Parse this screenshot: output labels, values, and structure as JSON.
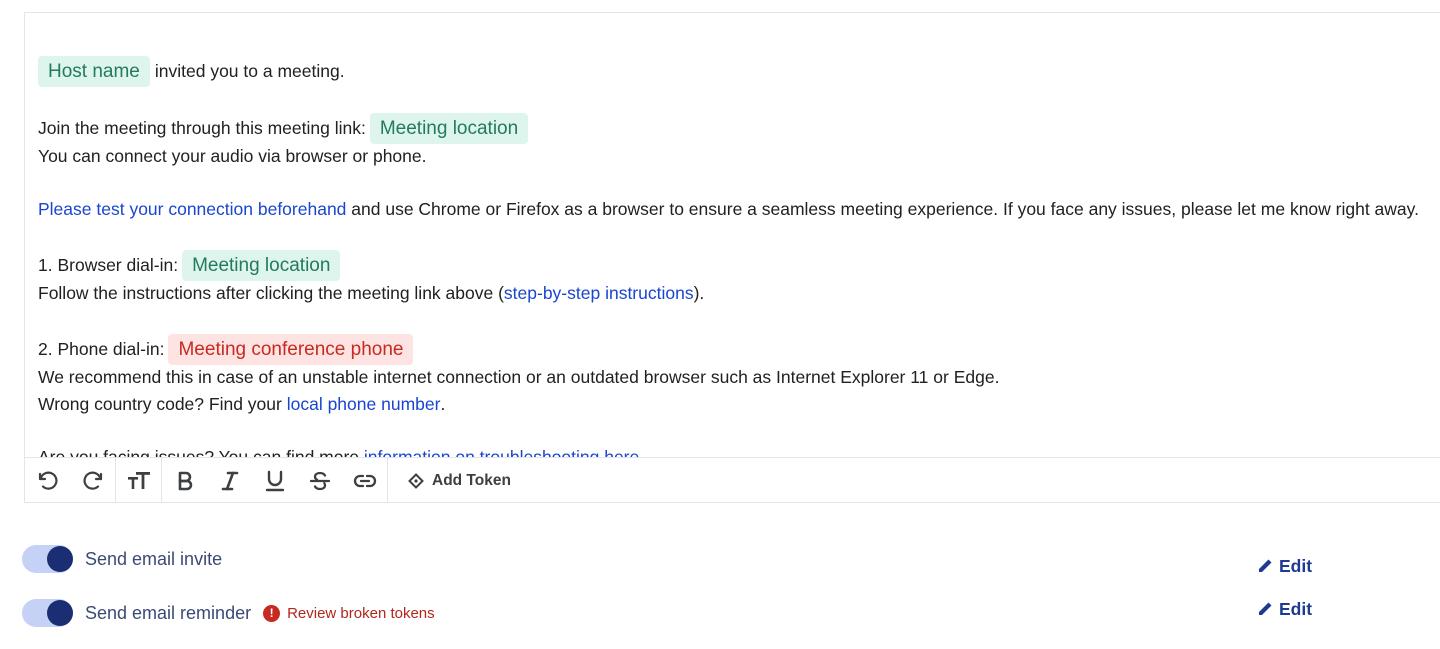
{
  "editor": {
    "line1": {
      "host_token": "Host name",
      "text": "invited you to a meeting."
    },
    "line2": {
      "text": "Join the meeting through this meeting link:",
      "token": "Meeting location"
    },
    "line3": {
      "text": "You can connect your audio via browser or phone."
    },
    "line4": {
      "link": "Please test your connection beforehand",
      "text": "and use Chrome or Firefox as a browser to ensure a seamless meeting experience. If you face any issues, please let me know right away."
    },
    "line5": {
      "text": "1. Browser dial-in:",
      "token": "Meeting location"
    },
    "line6": {
      "text_before": "Follow the instructions after clicking the meeting link above (",
      "link": "step-by-step instructions",
      "text_after": ")."
    },
    "line7": {
      "text": "2. Phone dial-in:",
      "token": "Meeting conference phone"
    },
    "line8": {
      "text": "We recommend this in case of an unstable internet connection or an outdated browser such as Internet Explorer 11 or Edge."
    },
    "line9": {
      "text_before": "Wrong country code? Find your",
      "link": "local phone number",
      "text_after": "."
    },
    "line10": {
      "text_before": "Are you facing issues? You can find more",
      "link": "information on troubleshooting here",
      "text_after": "."
    }
  },
  "toolbar": {
    "icons": [
      "undo-icon",
      "redo-icon",
      "text-size-icon",
      "bold-icon",
      "italic-icon",
      "underline-icon",
      "strikethrough-icon",
      "link-icon",
      "token-icon"
    ],
    "add_token_label": "Add Token"
  },
  "settings": {
    "invite": {
      "label": "Send email invite",
      "enabled": true,
      "edit_label": "Edit"
    },
    "reminder": {
      "label": "Send email reminder",
      "enabled": true,
      "warning": "Review broken tokens",
      "edit_label": "Edit"
    }
  },
  "colors": {
    "token_ok_bg": "#def5ee",
    "token_ok_text": "#237a5c",
    "token_bad_bg": "#fde4e3",
    "token_bad_text": "#c62a21",
    "link": "#1a45d0",
    "toggle_track": "#c5d2f5",
    "toggle_knob": "#1c2e73",
    "edit": "#1f3a93"
  }
}
